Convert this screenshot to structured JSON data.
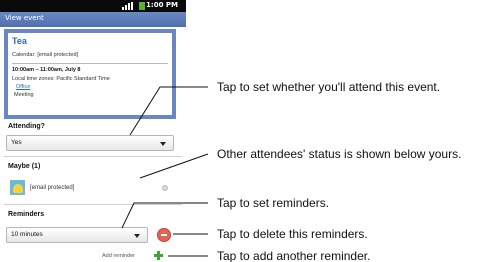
{
  "status_bar": {
    "time": "1:00 PM"
  },
  "title_bar": {
    "title": "View event"
  },
  "event": {
    "title": "Tea",
    "calendar": "Calendar: [email protected]",
    "time": "10:00am – 11:00am, July 8",
    "timezone": "Local time zones:  Pacific  Standard Time",
    "location": "Office",
    "description": "Meeting"
  },
  "attending": {
    "label": "Attending?",
    "value": "Yes"
  },
  "maybe": {
    "label": "Maybe (1)"
  },
  "attendee": {
    "email": "[email protected]"
  },
  "reminders": {
    "label": "Reminders",
    "value": "10 minutes",
    "add_label": "Add reminder"
  },
  "callouts": [
    "Tap to set whether you'll attend this event.",
    "Other attendees' status is shown below yours.",
    "Tap to set reminders.",
    "Tap to delete this reminders.",
    "Tap to add another reminder."
  ],
  "colors": {
    "title_bar": "#5a7ab8",
    "event_border": "#6a87c4",
    "add_green": "#3da63a",
    "remove_red": "#e06555"
  }
}
